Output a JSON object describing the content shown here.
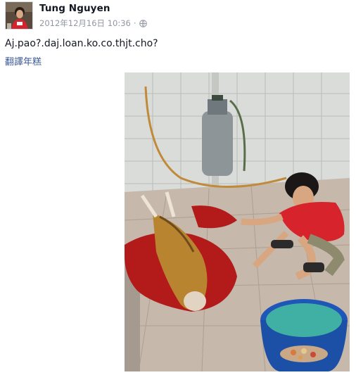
{
  "post": {
    "author_name": "Tung Nguyen",
    "timestamp": "2012年12月16日 10:36",
    "separator": "·",
    "privacy_icon": "globe-icon",
    "text": "Aj.pao?.daj.loan.ko.co.thjt.cho?",
    "translate_label": "翻譯年糕"
  },
  "photo": {
    "subject": "photo-attachment"
  },
  "colors": {
    "author": "#141823",
    "meta": "#9197a3",
    "link": "#3b5998",
    "text": "#141823"
  }
}
